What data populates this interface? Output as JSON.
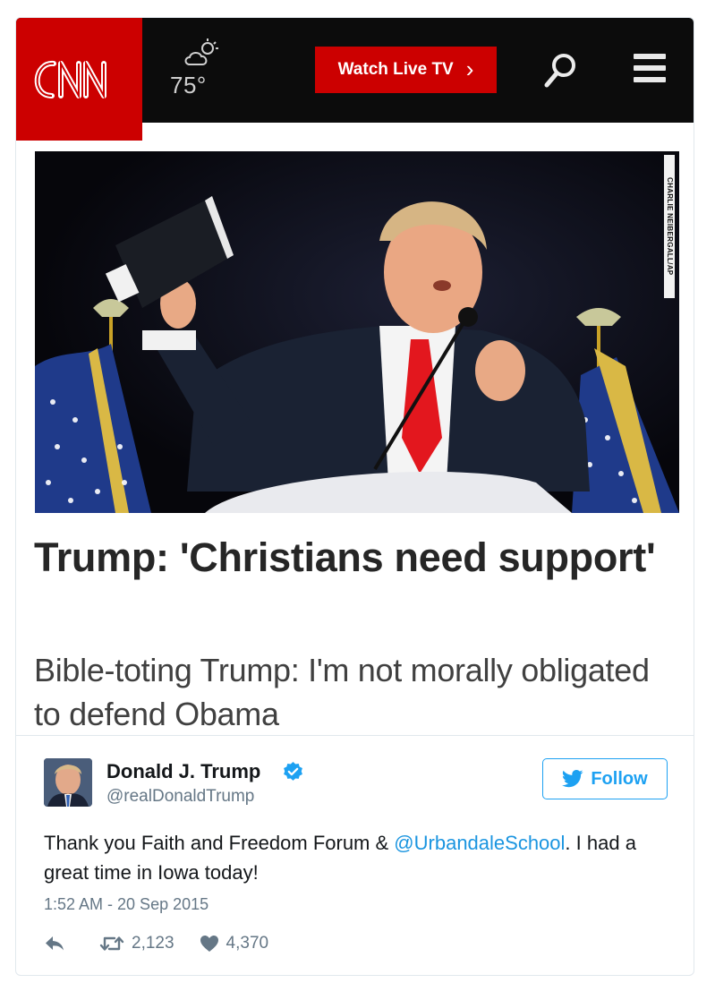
{
  "header": {
    "logo_text": "CNN",
    "weather_icon": "partly-cloudy-icon",
    "temperature": "75°",
    "watch_label": "Watch Live TV",
    "watch_chevron": "›",
    "search_icon": "search-icon",
    "menu_icon": "hamburger-menu-icon"
  },
  "article": {
    "photo_credit": "CHARLIE NEIBERGALL/AP",
    "headline": "Trump: 'Christians need support'",
    "subhead": "Bible-toting Trump: I'm not morally obligated to defend Obama"
  },
  "tweet": {
    "display_name": "Donald J. Trump",
    "handle": "@realDonaldTrump",
    "follow_label": "Follow",
    "text_before": "Thank you Faith and Freedom Forum & ",
    "mention": "@UrbandaleSchool",
    "text_after": ". I had a great time in Iowa today!",
    "timestamp": "1:52 AM - 20 Sep 2015",
    "retweets": "2,123",
    "likes": "4,370"
  },
  "colors": {
    "cnn_red": "#cc0000",
    "twitter_blue": "#1da1f2",
    "mention_blue": "#1b95e0"
  }
}
